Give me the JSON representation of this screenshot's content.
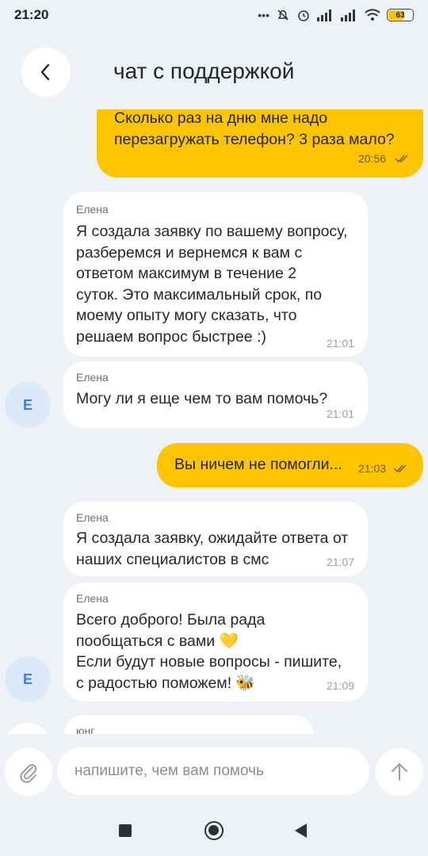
{
  "status_bar": {
    "time": "21:20",
    "battery": "63",
    "icons": [
      "more-dots-icon",
      "mute-icon",
      "alarm-icon",
      "signal-icon",
      "signal-icon",
      "wifi-icon",
      "battery-icon"
    ]
  },
  "header": {
    "title": "чат с поддержкой",
    "back_icon": "chevron-left-icon"
  },
  "messages": [
    {
      "direction": "out",
      "text": "Сколько раз на дню мне надо\nперезагружать телефон? 3 раза мало?",
      "time": "20:56",
      "status": "read"
    },
    {
      "direction": "in",
      "sender": "Елена",
      "text": "Я создала заявку по вашему вопросу,\nразберемся и вернемся к вам с\nответом максимум в течение 2\nсуток. Это максимальный срок, по\nмоему опыту могу сказать, что\nрешаем вопрос быстрее :)",
      "time": "21:01"
    },
    {
      "direction": "in",
      "sender": "Елена",
      "avatar": "Е",
      "text": "Могу ли я еще чем то вам помочь?",
      "time": "21:01"
    },
    {
      "direction": "out",
      "text": "Вы ничем не помогли...",
      "time": "21:03",
      "status": "read"
    },
    {
      "direction": "in",
      "sender": "Елена",
      "text": "Я создала заявку, ожидайте ответа от\nнаших специалистов в смс",
      "time": "21:07"
    },
    {
      "direction": "in",
      "sender": "Елена",
      "avatar": "Е",
      "text": "Всего доброго! Была рада\nпообщаться с вами 💛\nЕсли будут новые вопросы - пишите,\nс радостью поможем! 🐝",
      "time": "21:09"
    },
    {
      "direction": "in",
      "sender": "юнг",
      "text": "",
      "time": ""
    }
  ],
  "input": {
    "placeholder": "напишите, чем вам помочь",
    "attach_icon": "paperclip-icon",
    "send_icon": "arrow-up-icon"
  },
  "colors": {
    "outgoing": "#fdc500",
    "incoming": "#ffffff",
    "background": "#eef1f6",
    "avatar_bg": "#dce9fb",
    "avatar_text": "#3d7fd8"
  }
}
